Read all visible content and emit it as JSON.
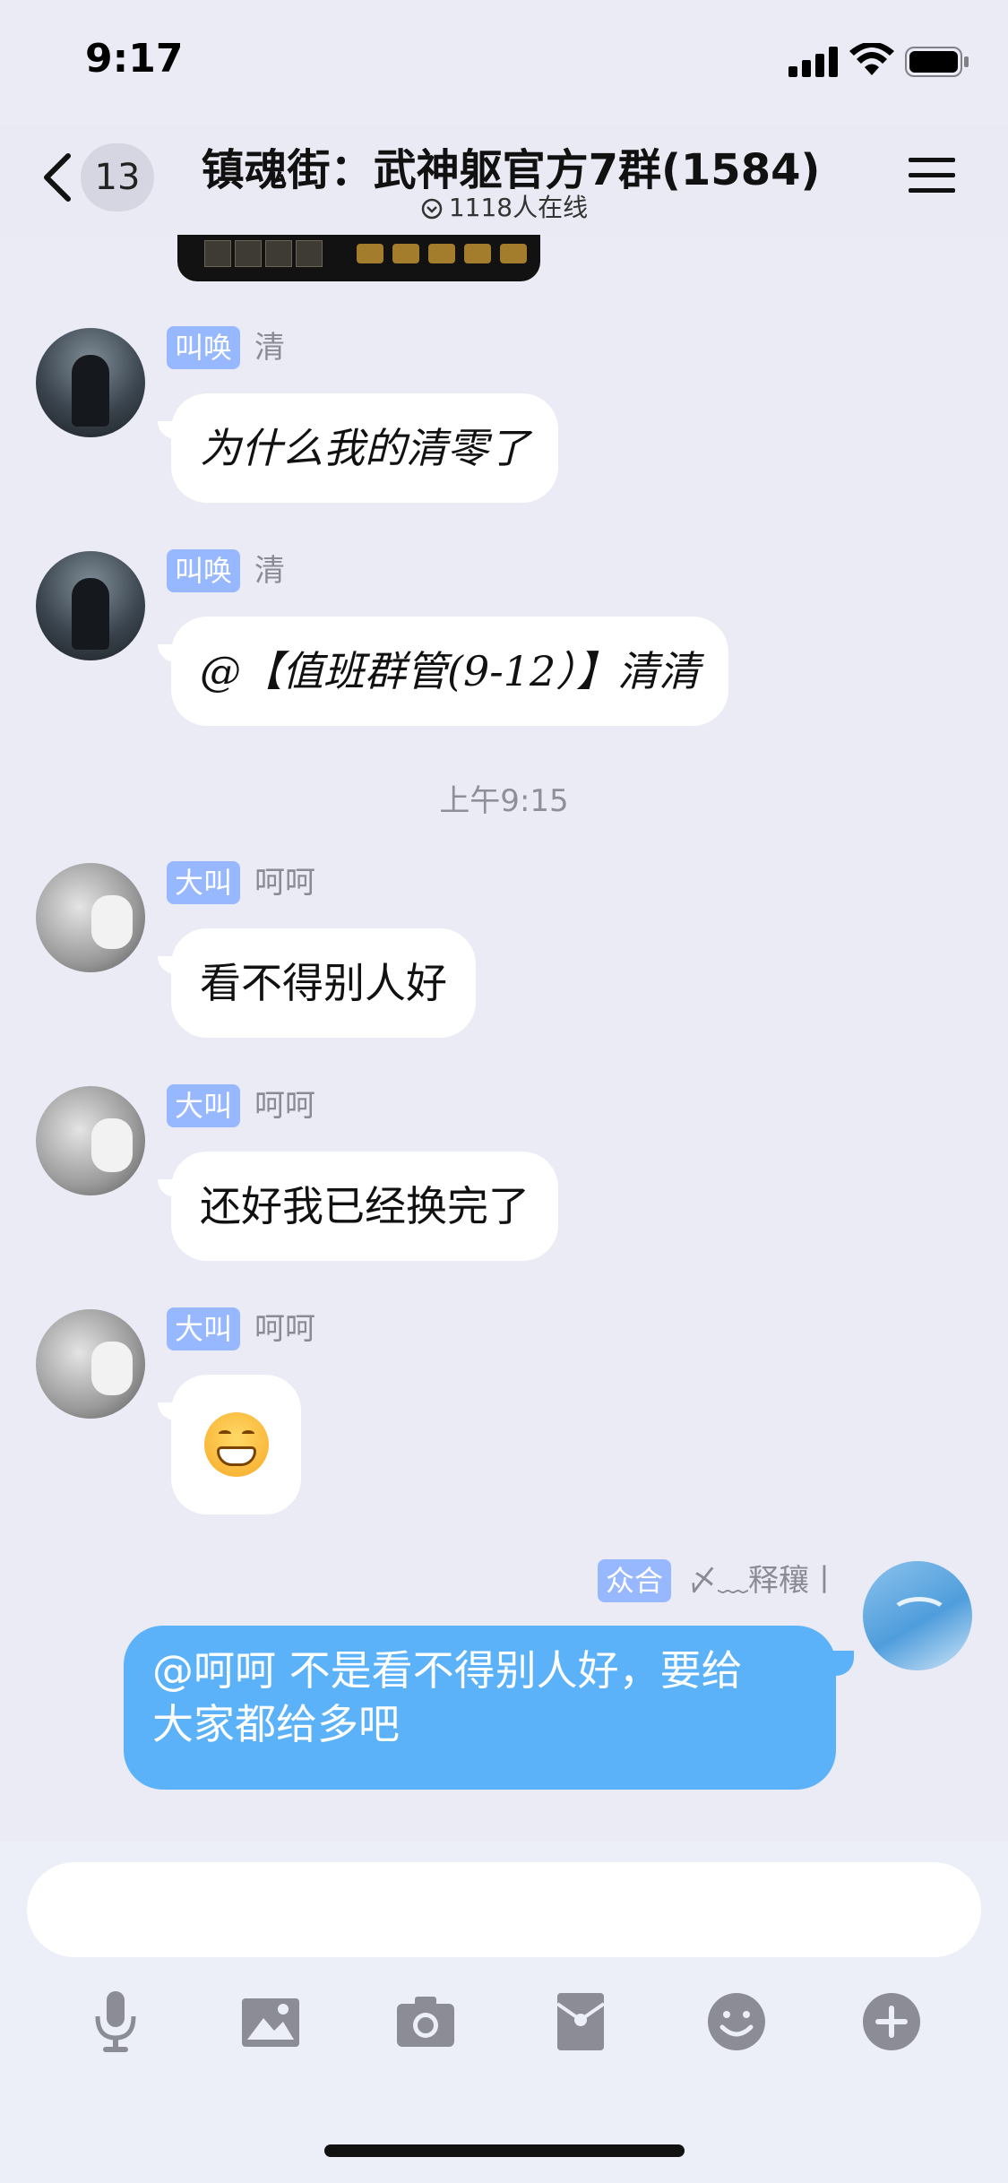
{
  "status_bar": {
    "time": "9:17"
  },
  "nav": {
    "unread_count": "13",
    "title": "镇魂街：武神躯官方7群(1584)",
    "online": "1118人在线"
  },
  "messages": [
    {
      "tag": "叫唤",
      "sender": "清",
      "text": "为什么我的清零了"
    },
    {
      "tag": "叫唤",
      "sender": "清",
      "text": "@【值班群管(9-12）】清清"
    },
    {
      "tag": "大叫",
      "sender": "呵呵",
      "text": "看不得别人好"
    },
    {
      "tag": "大叫",
      "sender": "呵呵",
      "text": "还好我已经换完了"
    },
    {
      "tag": "大叫",
      "sender": "呵呵",
      "text": "grinning-emoji"
    }
  ],
  "timestamp": "上午9:15",
  "self_message": {
    "tag": "众合",
    "sender": "〆﹏释穰丨",
    "line1": "@呵呵 不是看不得别人好，要给",
    "line2": "大家都给多吧"
  },
  "input": {
    "placeholder": ""
  },
  "toolbar": [
    "microphone-icon",
    "image-icon",
    "camera-icon",
    "red-packet-icon",
    "emoji-icon",
    "plus-icon"
  ],
  "colors": {
    "accent": "#5bb2f8",
    "tag": "#97b8ff",
    "background": "#eaebf5"
  }
}
